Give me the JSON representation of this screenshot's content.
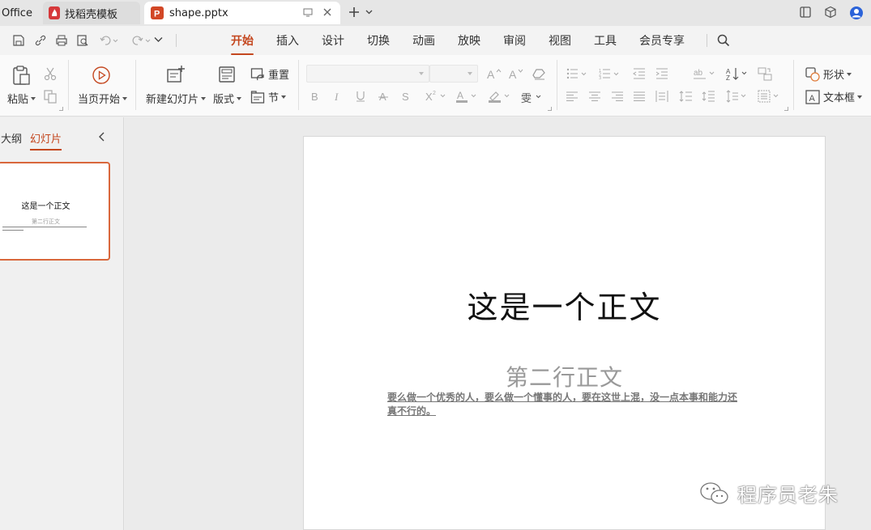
{
  "tabs": {
    "office_label": "Office",
    "templates_label": "找稻壳模板",
    "doc_label": "shape.pptx"
  },
  "menu": {
    "items": [
      "开始",
      "插入",
      "设计",
      "切换",
      "动画",
      "放映",
      "审阅",
      "视图",
      "工具",
      "会员专享"
    ],
    "active_index": 0
  },
  "ribbon": {
    "paste_label": "粘贴",
    "start_from_current_label": "当页开始",
    "new_slide_label": "新建幻灯片",
    "layout_label": "版式",
    "reset_label": "重置",
    "section_label": "节",
    "shape_label": "形状",
    "textbox_label": "文本框"
  },
  "left_panel": {
    "outline_label": "大纲",
    "slides_label": "幻灯片",
    "thumb_title": "这是一个正文",
    "thumb_subtitle": "第二行正文"
  },
  "slide": {
    "title": "这是一个正文",
    "subtitle": "第二行正文",
    "body": "要么做一个优秀的人，要么做一个懂事的人，要在这世上混，没一点本事和能力还真不行的。"
  },
  "watermark": {
    "text": "程序员老朱"
  },
  "colors": {
    "accent": "#c4471f",
    "thumb_border": "#d9673c"
  }
}
